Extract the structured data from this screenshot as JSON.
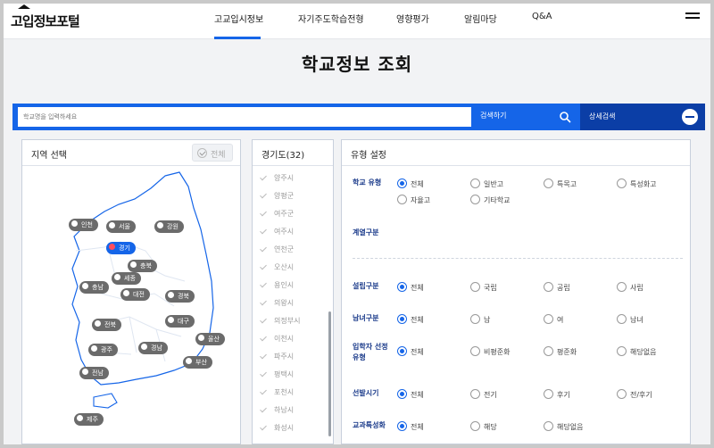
{
  "header": {
    "logo": "고입정보포털",
    "nav": [
      "고교입시정보",
      "자기주도학습전형",
      "영향평가",
      "알림마당",
      "Q&A"
    ],
    "active_nav": "고교입시정보"
  },
  "page_title": "학교정보 조회",
  "search": {
    "placeholder": "학교명을 입력하세요",
    "button_label": "검색하기",
    "detail_label": "상세검색"
  },
  "region": {
    "title": "지역 선택",
    "all_label": "전체",
    "pins": [
      "인천",
      "서울",
      "강원",
      "경기",
      "충북",
      "세종",
      "충남",
      "대전",
      "경북",
      "전북",
      "대구",
      "광주",
      "경남",
      "울산",
      "부산",
      "전남",
      "제주"
    ],
    "active_pin": "경기"
  },
  "district": {
    "title": "경기도(32)",
    "items": [
      "양주시",
      "양평군",
      "여주군",
      "여주시",
      "연천군",
      "오산시",
      "용인시",
      "의왕시",
      "의정부시",
      "이천시",
      "파주시",
      "평택시",
      "포천시",
      "하남시",
      "화성시"
    ]
  },
  "filters": {
    "title": "유형 설정",
    "school_type": {
      "label": "학교 유형",
      "options": [
        "전체",
        "일반고",
        "특목고",
        "특성화고",
        "자율고",
        "기타학교"
      ],
      "selected": "전체"
    },
    "series": {
      "label": "계열구분"
    },
    "establishment": {
      "label": "설립구분",
      "options": [
        "전체",
        "국립",
        "공립",
        "사립"
      ],
      "selected": "전체"
    },
    "gender": {
      "label": "남녀구분",
      "options": [
        "전체",
        "남",
        "여",
        "남녀"
      ],
      "selected": "전체"
    },
    "admission": {
      "label": "입학자 선정유형",
      "options": [
        "전체",
        "비평준화",
        "평준화",
        "해당없음"
      ],
      "selected": "전체"
    },
    "period": {
      "label": "선발시기",
      "options": [
        "전체",
        "전기",
        "후기",
        "전/후기"
      ],
      "selected": "전체"
    },
    "specialization": {
      "label": "교과특성화",
      "options": [
        "전체",
        "해당",
        "해당없음"
      ],
      "selected": "전체"
    }
  },
  "colors": {
    "primary": "#1565e8",
    "dark_primary": "#0b3ea6",
    "label": "#1a3a8a"
  }
}
